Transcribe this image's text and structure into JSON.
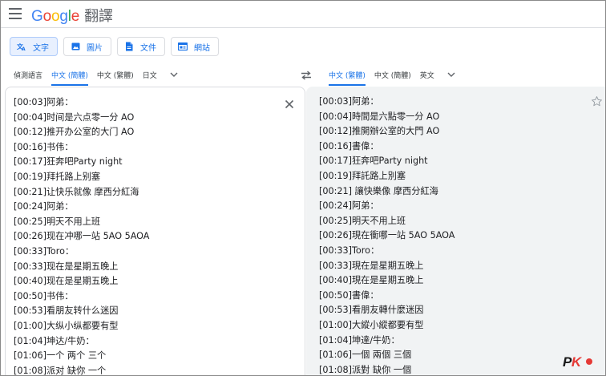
{
  "header": {
    "logo_text": "Google",
    "product_title": "翻譯"
  },
  "modes": [
    {
      "label": "文字",
      "icon": "text-translate-icon",
      "active": true
    },
    {
      "label": "圖片",
      "icon": "image-icon",
      "active": false
    },
    {
      "label": "文件",
      "icon": "document-icon",
      "active": false
    },
    {
      "label": "網站",
      "icon": "website-icon",
      "active": false
    }
  ],
  "source_langs": [
    {
      "label": "偵測語言",
      "active": false
    },
    {
      "label": "中文 (簡體)",
      "active": true
    },
    {
      "label": "中文 (繁體)",
      "active": false
    },
    {
      "label": "日文",
      "active": false
    }
  ],
  "target_langs": [
    {
      "label": "中文 (繁體)",
      "active": true
    },
    {
      "label": "中文 (簡體)",
      "active": false
    },
    {
      "label": "英文",
      "active": false
    }
  ],
  "source_text": [
    "[00:03]阿弟：",
    "[00:04]时间是六点零一分 AO",
    "[00:12]推开办公室的大门 AO",
    "[00:16]书伟：",
    "[00:17]狂奔吧Party night",
    "[00:19]拜托路上别塞",
    "[00:21]让快乐就像 摩西分紅海",
    "[00:24]阿弟：",
    "[00:25]明天不用上班",
    "[00:26]现在冲哪一站 5AO 5AOA",
    "[00:33]Toro：",
    "[00:33]现在是星期五晚上",
    "[00:40]现在是星期五晚上",
    "[00:50]书伟：",
    "[00:53]看朋友转什么迷因",
    "[01:00]大纵小纵都要有型",
    "[01:04]坤达/牛奶：",
    "[01:06]一个 两个 三个",
    "[01:08]派对 缺你 一个"
  ],
  "target_text": [
    "[00:03]阿弟：",
    "[00:04]時間是六點零一分 AO",
    "[00:12]推開辦公室的大門 AO",
    "[00:16]書偉：",
    "[00:17]狂奔吧Party night",
    "[00:19]拜託路上別塞",
    "[00:21] 讓快樂像 摩西分紅海",
    "[00:24]阿弟：",
    "[00:25]明天不用上班",
    "[00:26]現在衝哪一站 5AO 5AOA",
    "[00:33]Toro：",
    "[00:33]現在是星期五晚上",
    "[00:40]現在是星期五晚上",
    "[00:50]書偉：",
    "[00:53]看朋友轉什麼迷因",
    "[01:00]大縱小縱都要有型",
    "[01:04]坤達/牛奶：",
    "[01:06]一個 兩個 三個",
    "[01:08]派對 缺你 一個"
  ],
  "watermark": {
    "p": "P",
    "k": "K"
  },
  "colors": {
    "accent": "#1a73e8",
    "target_bg": "#f1f3f4",
    "border": "#dadce0"
  }
}
